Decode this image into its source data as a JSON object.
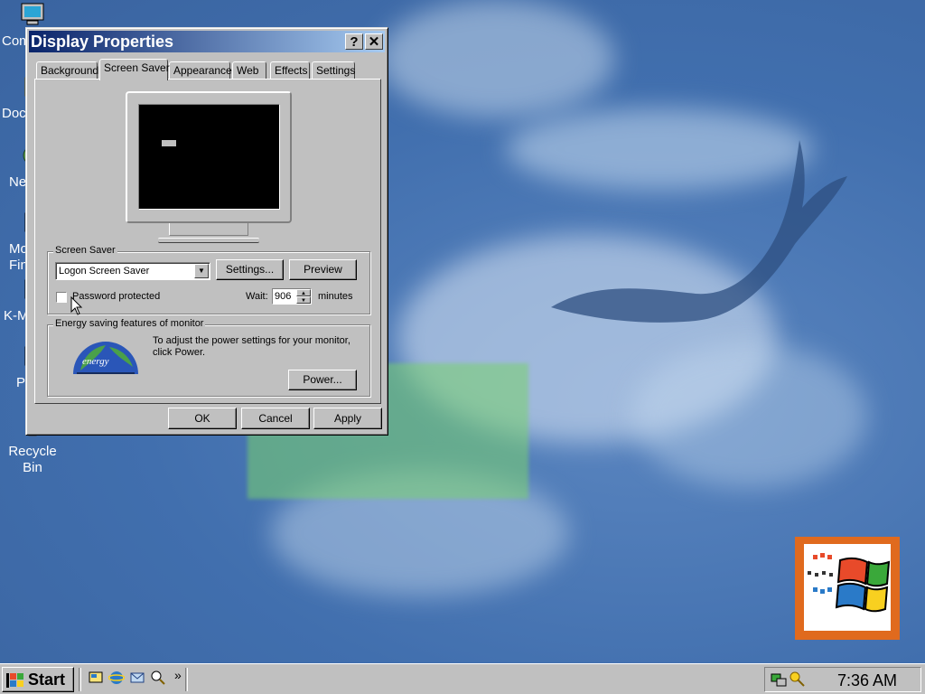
{
  "desktop": {
    "icons": [
      {
        "label": "Com",
        "icon": "my-computer-icon"
      },
      {
        "label": "Doc",
        "icon": "my-documents-icon"
      },
      {
        "label": "Ne",
        "icon": "network-icon"
      },
      {
        "label": "Mo\nFin",
        "icon": "app-icon"
      },
      {
        "label": "K-M",
        "icon": "app-icon"
      },
      {
        "label": "P",
        "icon": "app-icon"
      },
      {
        "label": "Recycle Bin",
        "icon": "recycle-bin-icon"
      }
    ]
  },
  "window": {
    "title": "Display Properties",
    "help_glyph": "?",
    "close_glyph": "✕",
    "tabs": [
      {
        "label": "Background"
      },
      {
        "label": "Screen Saver"
      },
      {
        "label": "Appearance"
      },
      {
        "label": "Web"
      },
      {
        "label": "Effects"
      },
      {
        "label": "Settings"
      }
    ],
    "active_tab": "Screen Saver",
    "screen_saver": {
      "group_label": "Screen Saver",
      "selected": "Logon Screen Saver",
      "settings_label": "Settings...",
      "preview_label": "Preview",
      "password_label": "Password protected",
      "password_checked": false,
      "wait_label": "Wait:",
      "wait_value": "906",
      "minutes_label": "minutes"
    },
    "energy": {
      "group_label": "Energy saving features of monitor",
      "description": "To adjust the power settings for your monitor, click Power.",
      "power_label": "Power...",
      "logo_text": "energy"
    },
    "buttons": {
      "ok": "OK",
      "cancel": "Cancel",
      "apply": "Apply"
    }
  },
  "taskbar": {
    "start_label": "Start",
    "chevron": "»",
    "clock": "7:36 AM"
  },
  "colors": {
    "title_start": "#0a246a",
    "title_end": "#a6caf0",
    "face": "#c0c0c0",
    "desktop": "#3f6aa8"
  }
}
